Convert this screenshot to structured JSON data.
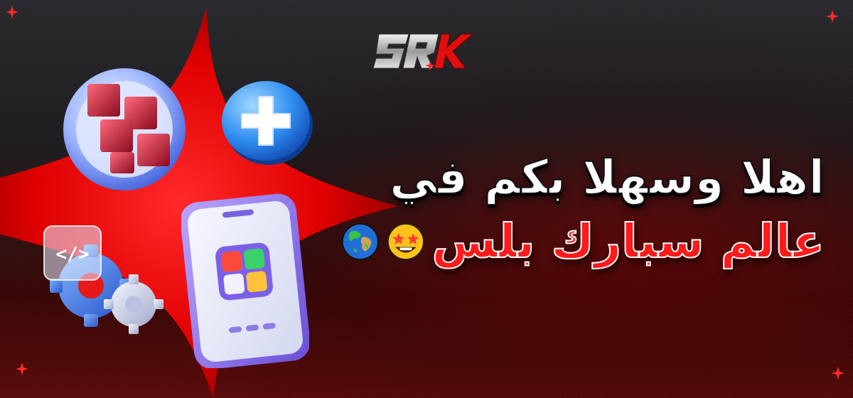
{
  "brand": {
    "logo_text": "SRK",
    "accent": "#ff1a1a",
    "dark": "#1d1d20"
  },
  "headline": {
    "line1": "اهلا وسهلا بكم في",
    "line2": "عالم سبارك بلس"
  },
  "icons": {
    "apps_cube": "red-blocks-icon",
    "plus": "plus-icon",
    "code_gears": "code-gears-icon",
    "phone": "phone-app-icon",
    "star_eyes": "star-struck-emoji-icon",
    "globe": "globe-emoji-icon"
  }
}
